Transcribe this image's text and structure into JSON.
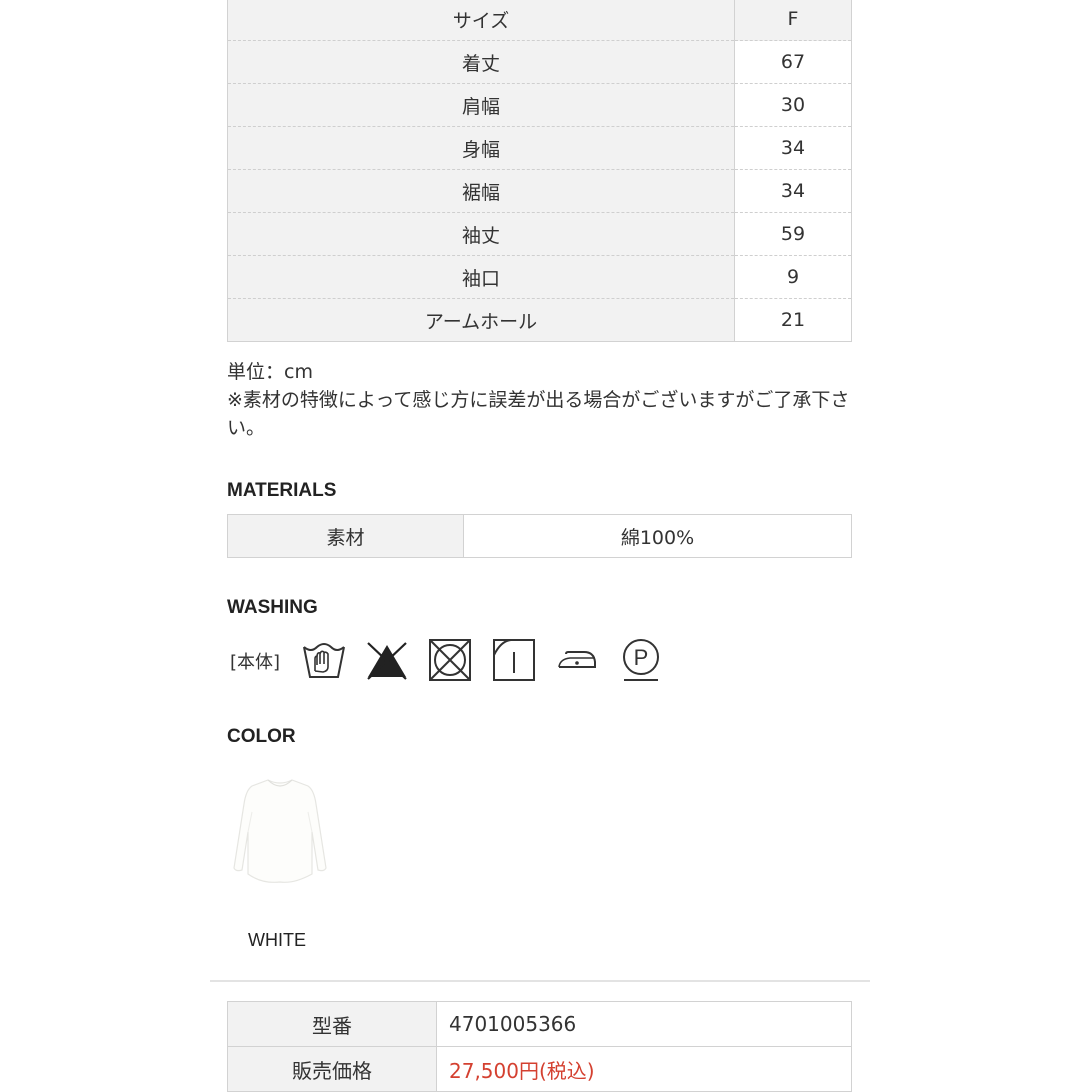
{
  "size_table": {
    "header": {
      "label": "サイズ",
      "value": "F"
    },
    "rows": [
      {
        "label": "着丈",
        "value": "67"
      },
      {
        "label": "肩幅",
        "value": "30"
      },
      {
        "label": "身幅",
        "value": "34"
      },
      {
        "label": "裾幅",
        "value": "34"
      },
      {
        "label": "袖丈",
        "value": "59"
      },
      {
        "label": "袖口",
        "value": "9"
      },
      {
        "label": "アームホール",
        "value": "21"
      }
    ]
  },
  "notes": {
    "unit": "単位：cm",
    "disclaimer": "※素材の特徴によって感じ方に誤差が出る場合がございますがご了承下さい。"
  },
  "materials": {
    "heading": "MATERIALS",
    "label": "素材",
    "value": "綿100%"
  },
  "washing": {
    "heading": "WASHING",
    "label": "[本体]",
    "icons": [
      "hand-wash-icon",
      "do-not-bleach-icon",
      "do-not-tumble-dry-icon",
      "line-dry-icon",
      "low-iron-icon",
      "dry-clean-p-icon"
    ],
    "dry_clean_letter": "P"
  },
  "color": {
    "heading": "COLOR",
    "swatch_icon": "white-long-sleeve-shirt",
    "name": "WHITE"
  },
  "info": {
    "model_label": "型番",
    "model_value": "4701005366",
    "price_label": "販売価格",
    "price_value": "27,500円(税込)",
    "price_color": "#d44030"
  }
}
